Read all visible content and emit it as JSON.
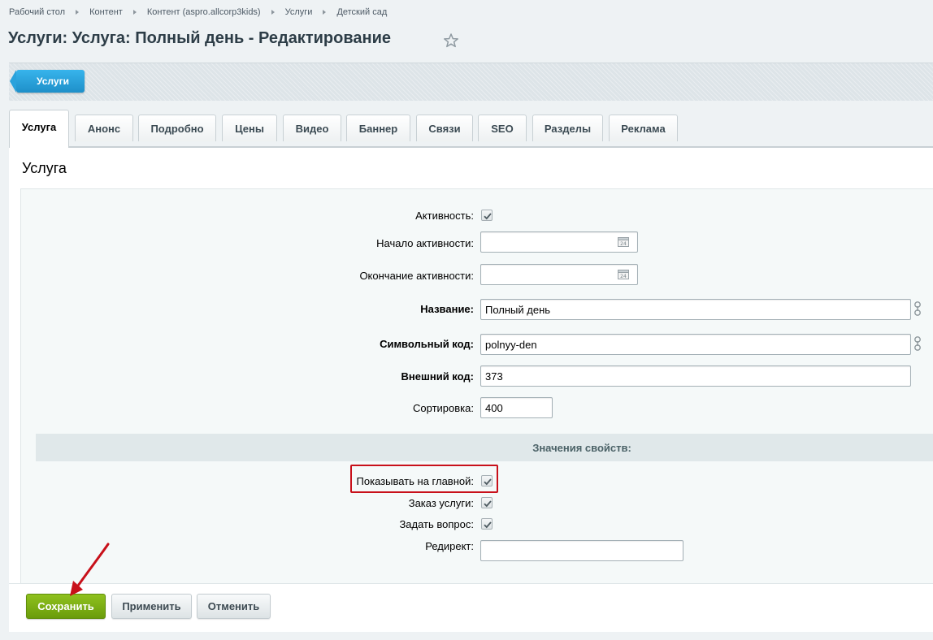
{
  "breadcrumb": {
    "items": [
      "Рабочий стол",
      "Контент",
      "Контент (aspro.allcorp3kids)",
      "Услуги",
      "Детский сад"
    ]
  },
  "page": {
    "title": "Услуги: Услуга: Полный день - Редактирование",
    "favorite_icon": "star-icon"
  },
  "context_bar": {
    "back_label": "Услуги"
  },
  "tabs": [
    {
      "label": "Услуга",
      "active": true
    },
    {
      "label": "Анонс"
    },
    {
      "label": "Подробно"
    },
    {
      "label": "Цены"
    },
    {
      "label": "Видео"
    },
    {
      "label": "Баннер"
    },
    {
      "label": "Связи"
    },
    {
      "label": "SEO"
    },
    {
      "label": "Разделы"
    },
    {
      "label": "Реклама"
    }
  ],
  "section": {
    "title": "Услуга"
  },
  "fields": {
    "active": {
      "label": "Активность:",
      "checked": true
    },
    "active_from": {
      "label": "Начало активности:",
      "value": ""
    },
    "active_to": {
      "label": "Окончание активности:",
      "value": ""
    },
    "name": {
      "label": "Название:",
      "value": "Полный день"
    },
    "code": {
      "label": "Символьный код:",
      "value": "polnyy-den"
    },
    "xml_id": {
      "label": "Внешний код:",
      "value": "373"
    },
    "sort": {
      "label": "Сортировка:",
      "value": "400"
    }
  },
  "properties": {
    "header": "Значения свойств:",
    "show_on_main": {
      "label": "Показывать на главной:",
      "checked": true
    },
    "order_service": {
      "label": "Заказ услуги:",
      "checked": true
    },
    "ask_question": {
      "label": "Задать вопрос:",
      "checked": true
    },
    "redirect": {
      "label": "Редирект:",
      "value": ""
    }
  },
  "buttons": {
    "save": "Сохранить",
    "apply": "Применить",
    "cancel": "Отменить"
  },
  "colors": {
    "accent_blue": "#1e8fc9",
    "save_green": "#7aaf14",
    "annotation_red": "#c8101a"
  }
}
